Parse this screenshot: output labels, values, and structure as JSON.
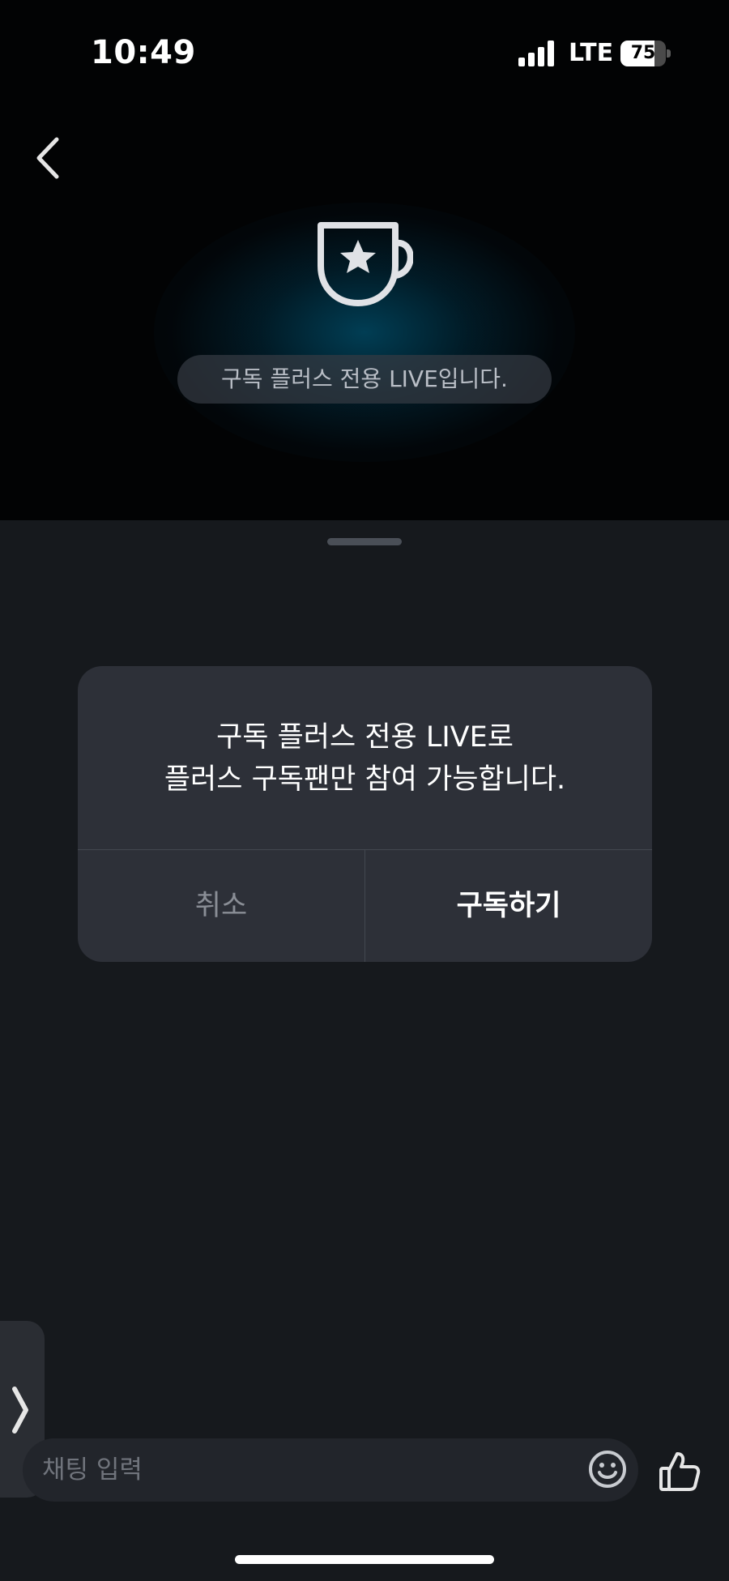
{
  "status_bar": {
    "time": "10:49",
    "network": "LTE",
    "battery_percent": "75",
    "battery_level": 0.75
  },
  "video": {
    "badge_icon": "star-cup-icon",
    "notice": "구독 플러스 전용 LIVE입니다."
  },
  "dialog": {
    "message_line1": "구독 플러스 전용 LIVE로",
    "message_line2": "플러스 구독팬만 참여 가능합니다.",
    "cancel_label": "취소",
    "subscribe_label": "구독하기"
  },
  "chat": {
    "input_placeholder": "채팅 입력",
    "emoji_icon": "smile-icon",
    "like_icon": "thumbs-up-icon"
  },
  "colors": {
    "background": "#020304",
    "sheet": "#16191d",
    "dialog": "#2d3038",
    "glow": "#006e96"
  }
}
